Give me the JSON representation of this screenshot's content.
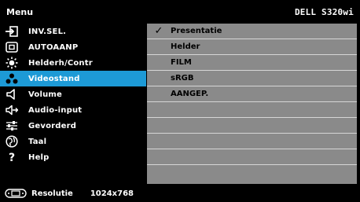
{
  "header": {
    "title": "Menu",
    "model": "DELL S320wi"
  },
  "menu": [
    {
      "label": "INV.SEL.",
      "icon": "input-select-icon"
    },
    {
      "label": "AUTOAANP",
      "icon": "auto-adjust-icon"
    },
    {
      "label": "Helderh/Contr",
      "icon": "brightness-icon"
    },
    {
      "label": "Videostand",
      "icon": "video-mode-icon",
      "selected": true
    },
    {
      "label": "Volume",
      "icon": "volume-icon"
    },
    {
      "label": "Audio-input",
      "icon": "audio-input-icon"
    },
    {
      "label": "Gevorderd",
      "icon": "advanced-settings-icon"
    },
    {
      "label": "Taal",
      "icon": "language-icon"
    },
    {
      "label": "Help",
      "icon": "help-icon"
    }
  ],
  "options": [
    {
      "label": "Presentatie",
      "checked": true
    },
    {
      "label": "Helder"
    },
    {
      "label": "FILM"
    },
    {
      "label": "sRGB"
    },
    {
      "label": "AANGEP."
    }
  ],
  "footer": {
    "label": "Resolutie",
    "value": "1024x768",
    "icon": "resolution-icon"
  },
  "colors": {
    "selected": "#1d9ad6",
    "panel": "#8a8a8a",
    "background": "#000000"
  }
}
